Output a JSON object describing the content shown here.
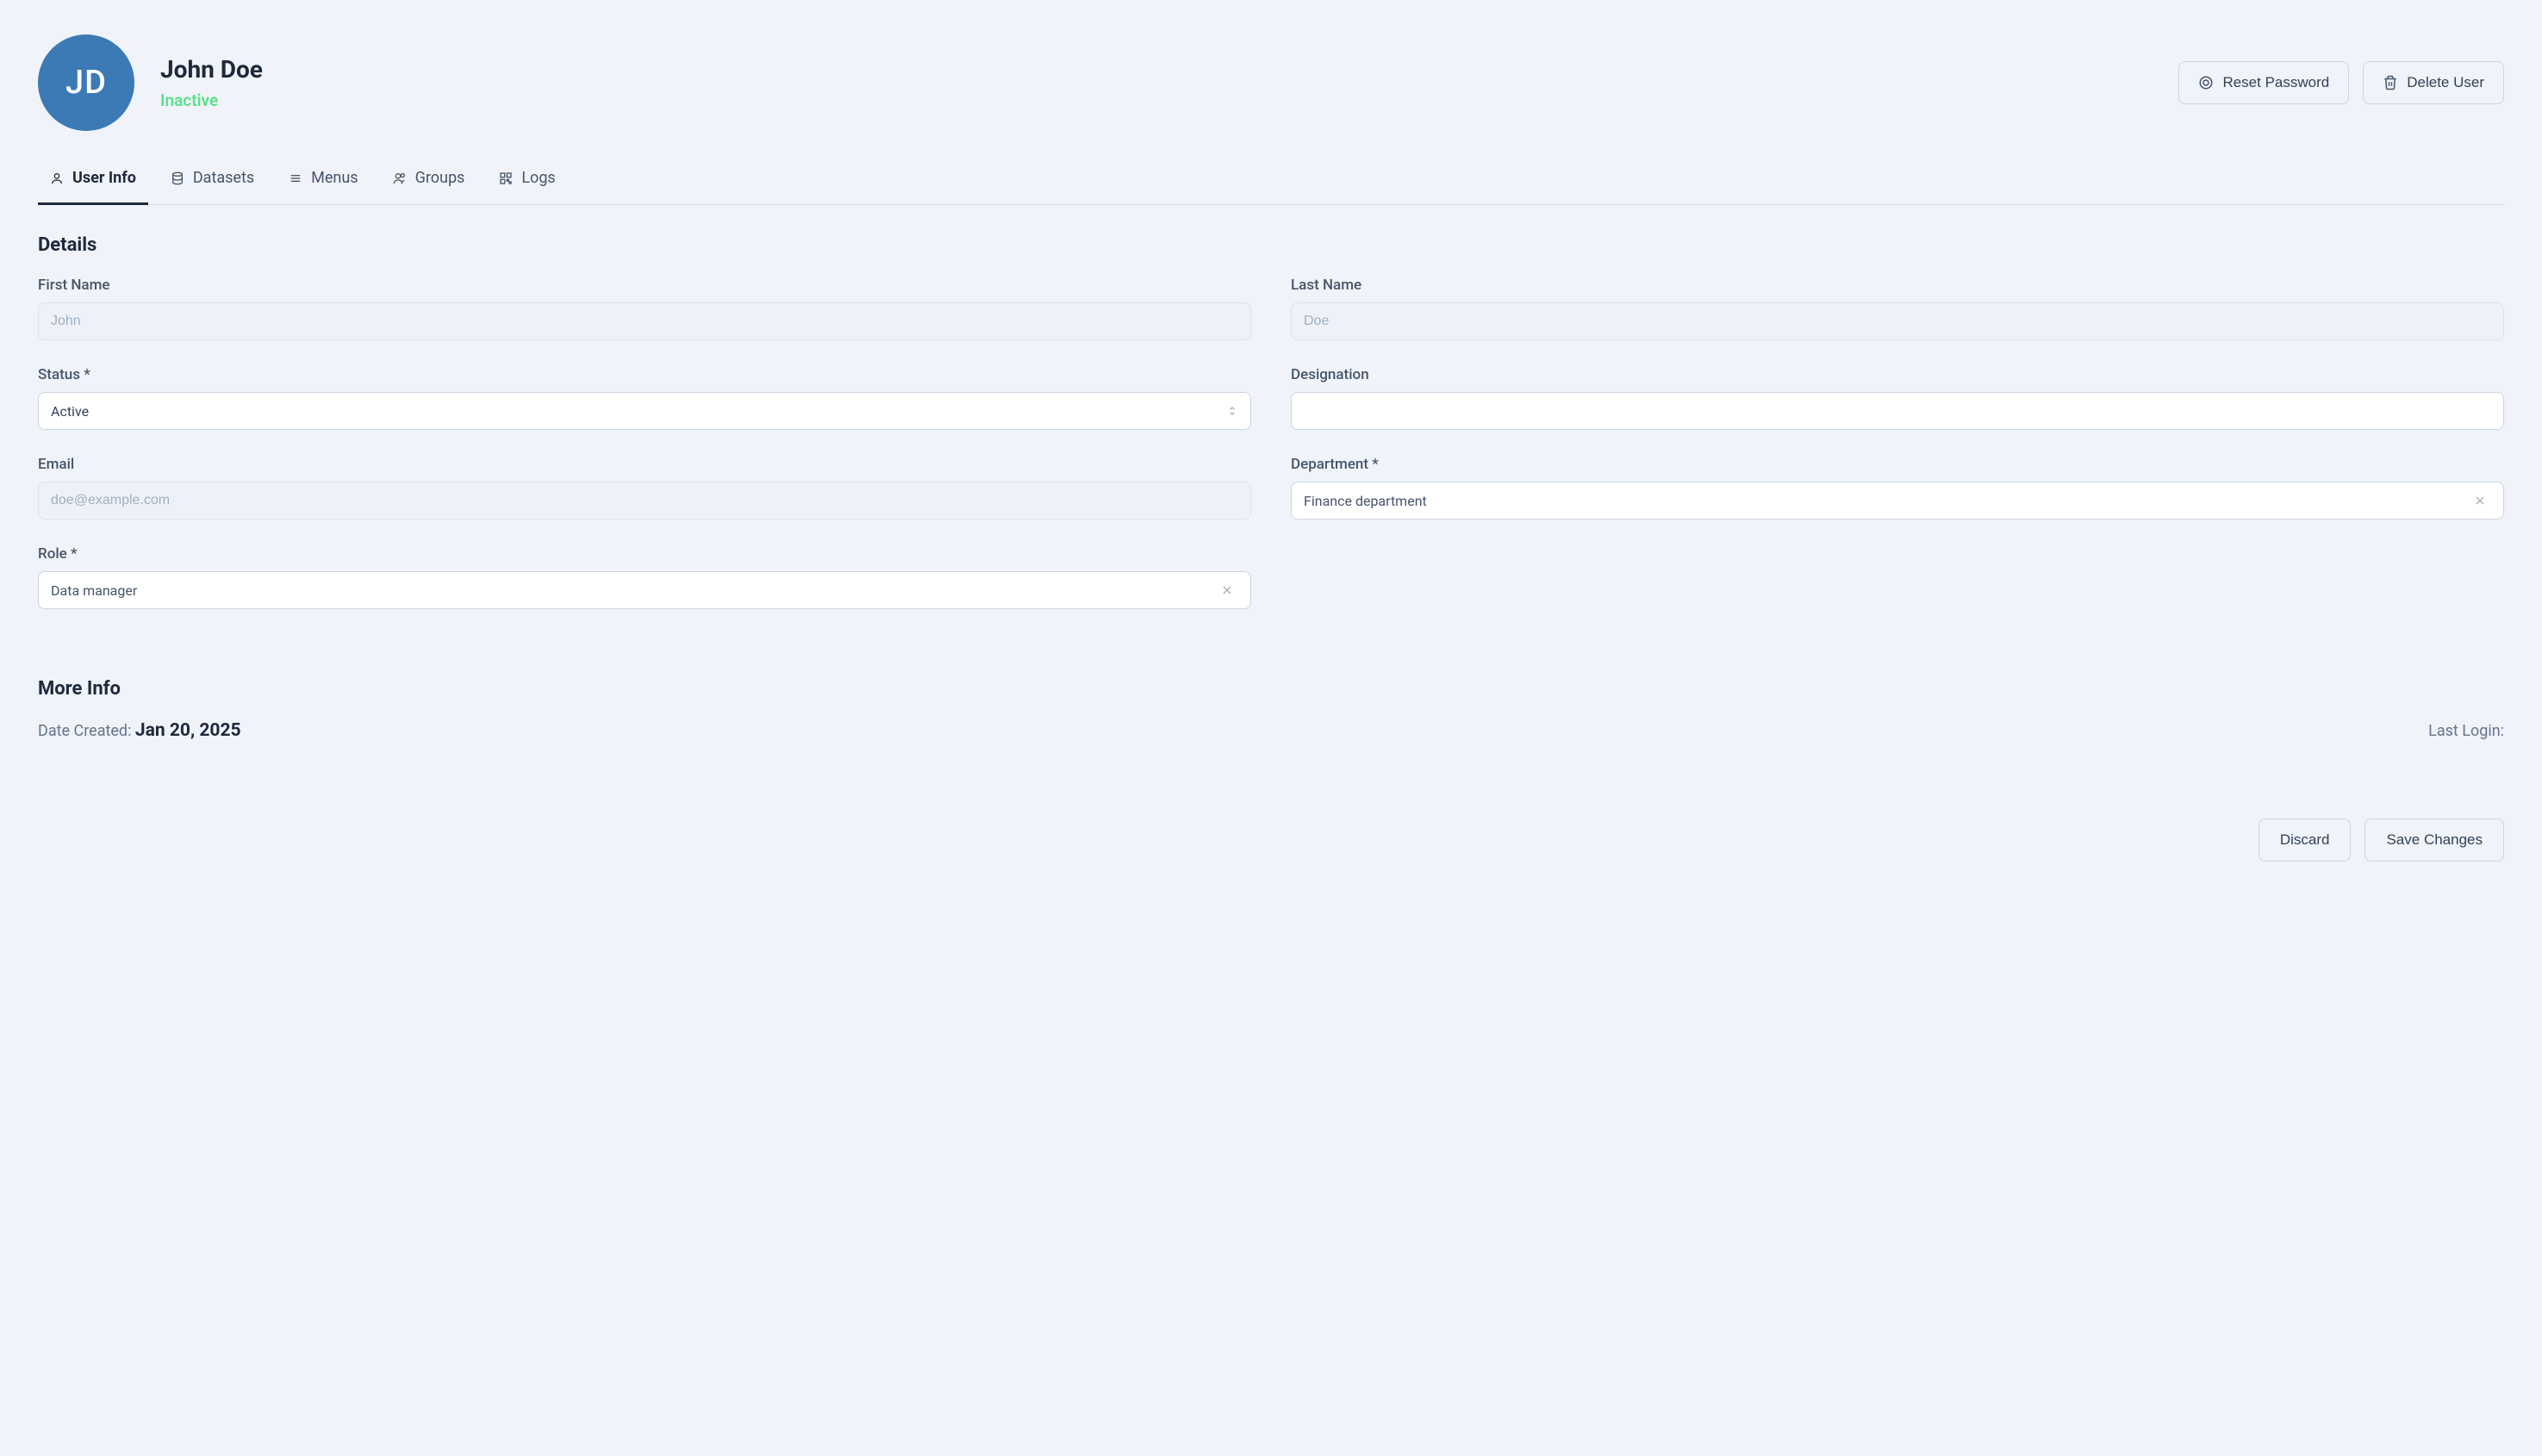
{
  "header": {
    "avatar_initials": "JD",
    "name": "John Doe",
    "status": "Inactive",
    "reset_password_label": "Reset Password",
    "delete_user_label": "Delete User"
  },
  "tabs": {
    "user_info": "User Info",
    "datasets": "Datasets",
    "menus": "Menus",
    "groups": "Groups",
    "logs": "Logs"
  },
  "sections": {
    "details": "Details",
    "more_info": "More Info"
  },
  "fields": {
    "first_name": {
      "label": "First Name",
      "placeholder": "John",
      "value": ""
    },
    "last_name": {
      "label": "Last Name",
      "placeholder": "Doe",
      "value": ""
    },
    "status": {
      "label": "Status *",
      "value": "Active"
    },
    "designation": {
      "label": "Designation",
      "value": ""
    },
    "email": {
      "label": "Email",
      "placeholder": "doe@example.com",
      "value": ""
    },
    "department": {
      "label": "Department *",
      "value": "Finance department"
    },
    "role": {
      "label": "Role *",
      "value": "Data manager"
    }
  },
  "more": {
    "date_created_label": "Date Created: ",
    "date_created_value": "Jan 20, 2025",
    "last_login_label": "Last Login:",
    "last_login_value": ""
  },
  "footer": {
    "discard": "Discard",
    "save": "Save Changes"
  }
}
